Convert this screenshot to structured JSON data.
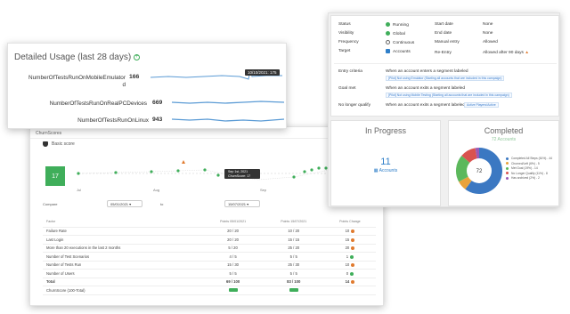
{
  "churn": {
    "header": "ChurnScores",
    "subtitle": "Basic score",
    "score": "17",
    "months": [
      "Jul",
      "Aug",
      "Sep",
      "Oct"
    ],
    "tooltip": {
      "date": "Sep 1st, 2021",
      "label": "ChurnScore: 17"
    },
    "compare_label": "Compare",
    "compare_to": "to",
    "date_from": "05/01/2021",
    "date_to": "15/07/2021",
    "columns": [
      "Factor",
      "Points 05/01/2021",
      "Points 15/07/2021",
      "Points Change"
    ],
    "rows": [
      {
        "factor": "Failure Rate",
        "a": "20 / 20",
        "b": "10 / 20",
        "chg": "10"
      },
      {
        "factor": "Last Login",
        "a": "20 / 20",
        "b": "15 / 15",
        "chg": "15"
      },
      {
        "factor": "More than 20 executions in the last 2 months",
        "a": "5 / 20",
        "b": "25 / 20",
        "chg": "20"
      },
      {
        "factor": "Number of Test Scenarios",
        "a": "4 / 5",
        "b": "5 / 5",
        "chg": "1"
      },
      {
        "factor": "Number of Tests Run",
        "a": "15 / 30",
        "b": "25 / 30",
        "chg": "10"
      },
      {
        "factor": "Number of Users",
        "a": "5 / 5",
        "b": "5 / 5",
        "chg": "0"
      }
    ],
    "total": {
      "factor": "Total",
      "a": "69 / 100",
      "b": "83 / 100",
      "chg": "14"
    },
    "final_label": "ChurnScore (100-Total)"
  },
  "usage": {
    "title": "Detailed Usage (last 28 days)",
    "tooltip": "10/10/2021: 175",
    "metrics": [
      {
        "label": "NumberOfTestsRunOnMobileEmulator",
        "label_wrap": "d",
        "value": "166"
      },
      {
        "label": "NumberOfTestsRunOnRealPCDevices",
        "value": "669"
      },
      {
        "label": "NumberOfTestsRunOnLinux",
        "value": "943"
      }
    ]
  },
  "campaign": {
    "status_label": "Status",
    "status": "Running",
    "visibility_label": "Visibility",
    "visibility": "Global",
    "frequency_label": "Frequency",
    "frequency": "Continuous",
    "target_label": "Target",
    "target": "Accounts",
    "start_label": "Start date",
    "start": "None",
    "end_label": "End date",
    "end": "None",
    "manual_label": "Manual entry",
    "manual": "Allowed",
    "reentry_label": "Re-Entry",
    "reentry": "Allowed after 90 days",
    "entry_label": "Entry criteria",
    "entry_text": "When an account enters a segment labeled",
    "entry_seg": "[Pilot] Not using Emulator (Starting all accounts that are included in this campaign)",
    "goal_label": "Goal met",
    "goal_text": "When an account exits a segment labeled",
    "goal_seg": "[Pilot] Not using Mobile Testing (Starting all accounts that are included in this campaign)",
    "nolonger_label": "No longer qualify",
    "nolonger_text": "When an account exits a segment labeled",
    "nolonger_seg": "Active Players/Active",
    "in_progress_title": "In Progress",
    "in_progress_value": "11",
    "in_progress_unit": "Accounts",
    "completed_title": "Completed",
    "completed_value": "72",
    "completed_unit": "Accounts",
    "donut_center": "72",
    "legend": [
      "Completed All Steps (61%) - 44",
      "Churned/Left (6%) - 5",
      "Met Goal (19%) - 14",
      "No Longer Qualify (11%) - 8",
      "Has archived (2%) - 2"
    ],
    "colors": {
      "running": "#3fae5a",
      "global": "#3fae5a",
      "blue": "#2f7fc9"
    }
  },
  "chart_data": {
    "type": "pie",
    "title": "Completed",
    "categories": [
      "Completed All Steps",
      "Churned/Left",
      "Met Goal",
      "No Longer Qualify",
      "Has archived"
    ],
    "values": [
      44,
      5,
      14,
      8,
      2
    ],
    "colors": [
      "#3b78c2",
      "#e9a23b",
      "#5cb85c",
      "#d9534f",
      "#9b59b6"
    ]
  }
}
